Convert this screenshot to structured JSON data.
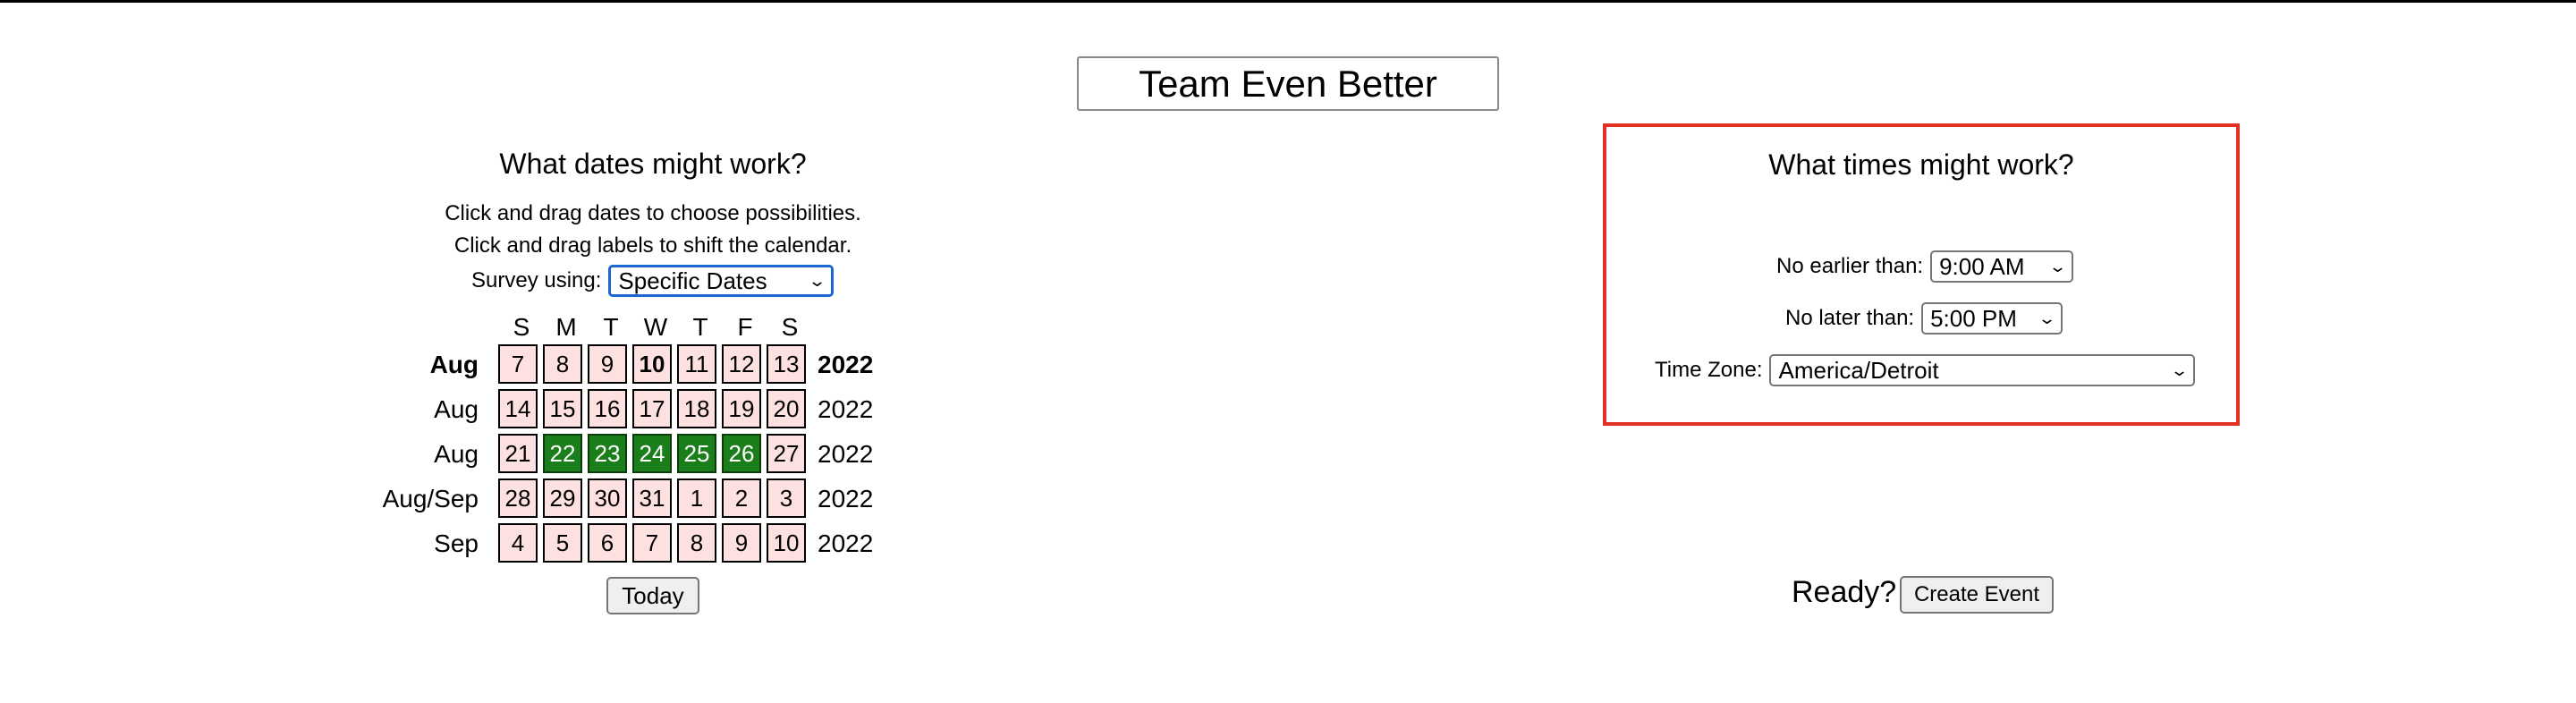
{
  "event": {
    "title": "Team Even Better"
  },
  "dates": {
    "heading": "What dates might work?",
    "instruction1": "Click and drag dates to choose possibilities.",
    "instruction2": "Click and drag labels to shift the calendar.",
    "survey_label": "Survey using:",
    "survey_value": "Specific Dates",
    "weekdays": [
      "S",
      "M",
      "T",
      "W",
      "T",
      "F",
      "S"
    ],
    "rows": [
      {
        "month": "Aug",
        "year": "2022",
        "days": [
          "7",
          "8",
          "9",
          "10",
          "11",
          "12",
          "13"
        ]
      },
      {
        "month": "Aug",
        "year": "2022",
        "days": [
          "14",
          "15",
          "16",
          "17",
          "18",
          "19",
          "20"
        ]
      },
      {
        "month": "Aug",
        "year": "2022",
        "days": [
          "21",
          "22",
          "23",
          "24",
          "25",
          "26",
          "27"
        ]
      },
      {
        "month": "Aug/Sep",
        "year": "2022",
        "days": [
          "28",
          "29",
          "30",
          "31",
          "1",
          "2",
          "3"
        ]
      },
      {
        "month": "Sep",
        "year": "2022",
        "days": [
          "4",
          "5",
          "6",
          "7",
          "8",
          "9",
          "10"
        ]
      }
    ],
    "selected_days": [
      "22",
      "23",
      "24",
      "25",
      "26"
    ],
    "today_day": "10",
    "today_button": "Today"
  },
  "times": {
    "heading": "What times might work?",
    "earliest_label": "No earlier than:",
    "earliest_value": "9:00 AM",
    "latest_label": "No later than:",
    "latest_value": "5:00 PM",
    "timezone_label": "Time Zone:",
    "timezone_value": "America/Detroit"
  },
  "footer": {
    "ready_label": "Ready?",
    "create_button": "Create Event"
  },
  "colors": {
    "selected": "#1a7f1a",
    "unselected": "#fde0e0",
    "highlight_border": "#e33022",
    "focus_border": "#1a67d2"
  }
}
